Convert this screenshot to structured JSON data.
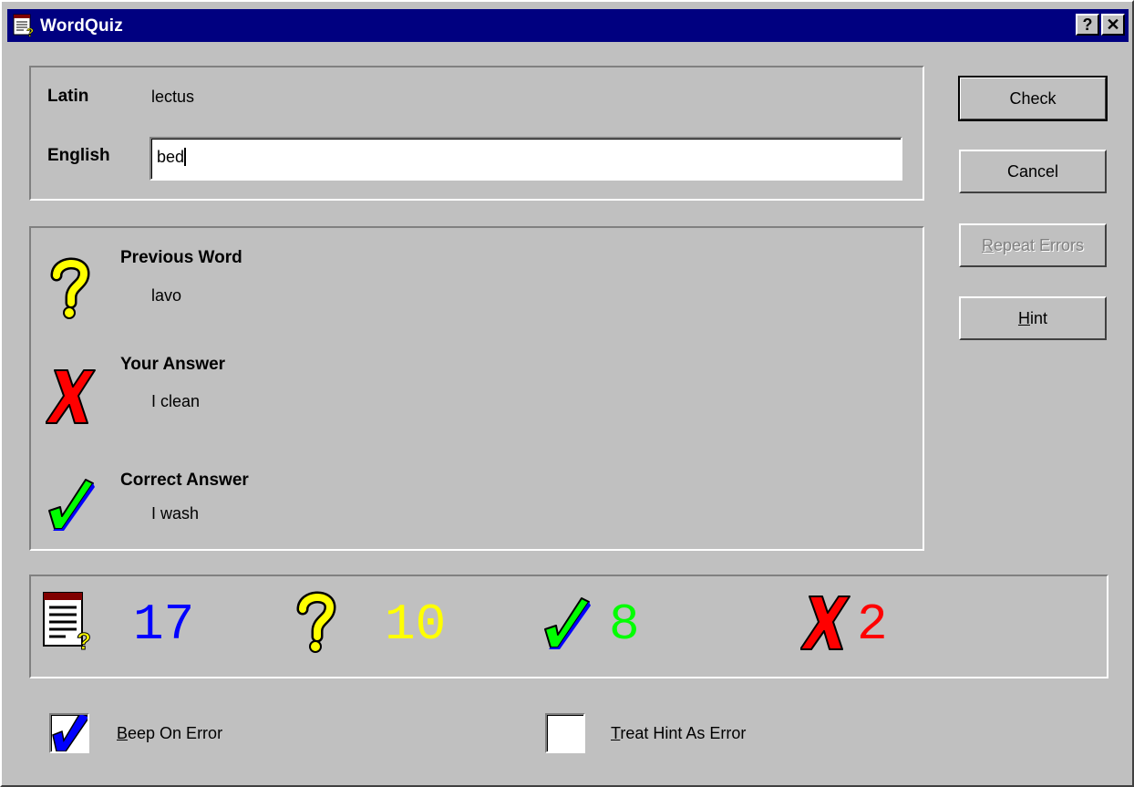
{
  "window": {
    "title": "WordQuiz",
    "help_button": "?",
    "close_button": "✕"
  },
  "quiz": {
    "source_language_label": "Latin",
    "source_word": "lectus",
    "target_language_label": "English",
    "answer_value": "bed"
  },
  "feedback": {
    "previous_word_label": "Previous Word",
    "previous_word": "lavo",
    "your_answer_label": "Your Answer",
    "your_answer": "I clean",
    "correct_answer_label": "Correct Answer",
    "correct_answer": "I wash"
  },
  "buttons": {
    "check": "Check",
    "cancel": "Cancel",
    "repeat_errors_mnemonic": "R",
    "repeat_errors_rest": "epeat Errors",
    "hint_mnemonic": "H",
    "hint_rest": "int"
  },
  "stats": {
    "total": "17",
    "remaining": "10",
    "correct": "8",
    "errors": "2",
    "colors": {
      "total": "#0000ff",
      "remaining": "#ffff00",
      "correct": "#00ff00",
      "errors": "#ff0000"
    }
  },
  "options": {
    "beep_mnemonic": "B",
    "beep_rest": "eep On Error",
    "beep_checked": true,
    "hint_error_mnemonic": "T",
    "hint_error_rest": "reat Hint As Error",
    "hint_error_checked": false
  }
}
